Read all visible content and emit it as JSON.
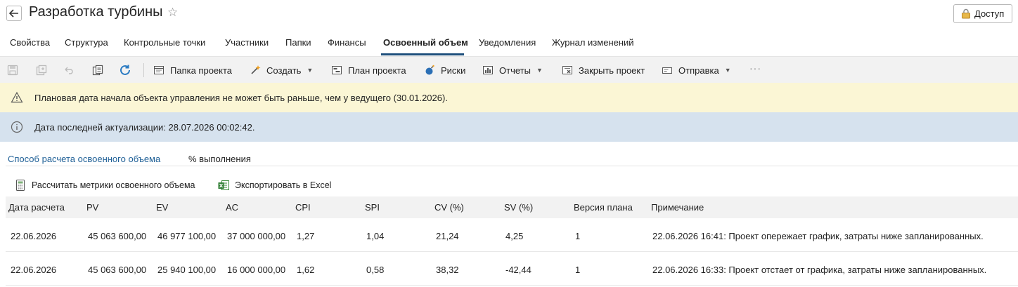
{
  "header": {
    "title": "Разработка турбины",
    "access_label": "Доступ"
  },
  "tabs": [
    {
      "label": "Свойства",
      "active": false
    },
    {
      "label": "Структура",
      "active": false
    },
    {
      "label": "Контрольные точки",
      "active": false
    },
    {
      "label": "Участники",
      "active": false
    },
    {
      "label": "Папки",
      "active": false
    },
    {
      "label": "Финансы",
      "active": false
    },
    {
      "label": "Освоенный объем",
      "active": true
    },
    {
      "label": "Уведомления",
      "active": false
    },
    {
      "label": "Журнал изменений",
      "active": false
    }
  ],
  "toolbar": {
    "project_folder": "Папка проекта",
    "create": "Создать",
    "project_plan": "План проекта",
    "risks": "Риски",
    "reports": "Отчеты",
    "close_project": "Закрыть проект",
    "send": "Отправка",
    "more": "···"
  },
  "banners": {
    "warning": "Плановая дата начала объекта управления не может быть раньше, чем у ведущего (30.01.2026).",
    "info": "Дата последней актуализации: 28.07.2026 00:02:42."
  },
  "method": {
    "label": "Способ расчета освоенного объема",
    "value": "% выполнения"
  },
  "actions": {
    "calculate": "Рассчитать метрики освоенного объема",
    "export": "Экспортировать в Excel"
  },
  "table": {
    "columns": [
      "Дата расчета",
      "PV",
      "EV",
      "AC",
      "CPI",
      "SPI",
      "CV (%)",
      "SV (%)",
      "Версия плана",
      "Примечание"
    ],
    "rows": [
      [
        "22.06.2026",
        "45 063 600,00",
        "46 977 100,00",
        "37 000 000,00",
        "1,27",
        "1,04",
        "21,24",
        "4,25",
        "1",
        "22.06.2026 16:41: Проект опережает график, затраты ниже запланированных."
      ],
      [
        "22.06.2026",
        "45 063 600,00",
        "25 940 100,00",
        "16 000 000,00",
        "1,62",
        "0,58",
        "38,32",
        "-42,44",
        "1",
        "22.06.2026 16:33: Проект отстает от графика, затраты ниже запланированных."
      ]
    ]
  },
  "colors": {
    "accent": "#1e4f7c",
    "link": "#1e5f96",
    "warning_bg": "#fbf6d5",
    "info_bg": "#d6e2ee",
    "toolbar_bg": "#f2f2f2"
  }
}
